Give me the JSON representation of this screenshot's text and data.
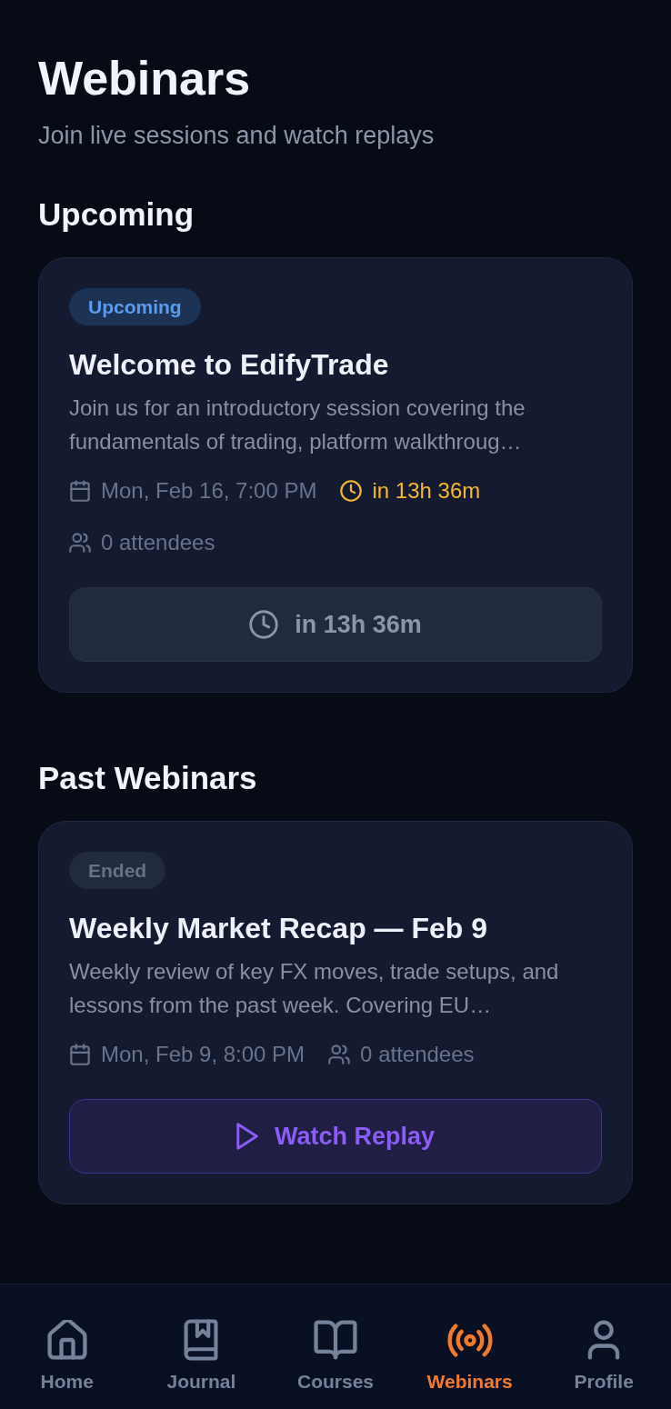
{
  "page": {
    "title": "Webinars",
    "subtitle": "Join live sessions and watch replays"
  },
  "sections": [
    {
      "heading": "Upcoming",
      "cards": [
        {
          "badge": {
            "kind": "upcoming",
            "label": "Upcoming"
          },
          "title": "Welcome to EdifyTrade",
          "description": "Join us for an introductory session covering the fundamentals of trading, platform walkthroug…",
          "date": "Mon, Feb 16, 7:00 PM",
          "countdown": "in 13h 36m",
          "attendees": "0 attendees",
          "button": {
            "kind": "countdown",
            "label": "in 13h 36m"
          }
        }
      ]
    },
    {
      "heading": "Past Webinars",
      "cards": [
        {
          "badge": {
            "kind": "ended",
            "label": "Ended"
          },
          "title": "Weekly Market Recap — Feb 9",
          "description": "Weekly review of key FX moves, trade setups, and lessons from the past week. Covering EU…",
          "date": "Mon, Feb 9, 8:00 PM",
          "attendees": "0 attendees",
          "button": {
            "kind": "replay",
            "label": "Watch Replay"
          }
        }
      ]
    }
  ],
  "tab_bar": [
    {
      "label": "Home",
      "selected": false
    },
    {
      "label": "Journal",
      "selected": false
    },
    {
      "label": "Courses",
      "selected": false
    },
    {
      "label": "Webinars",
      "selected": true
    },
    {
      "label": "Profile",
      "selected": false
    }
  ]
}
